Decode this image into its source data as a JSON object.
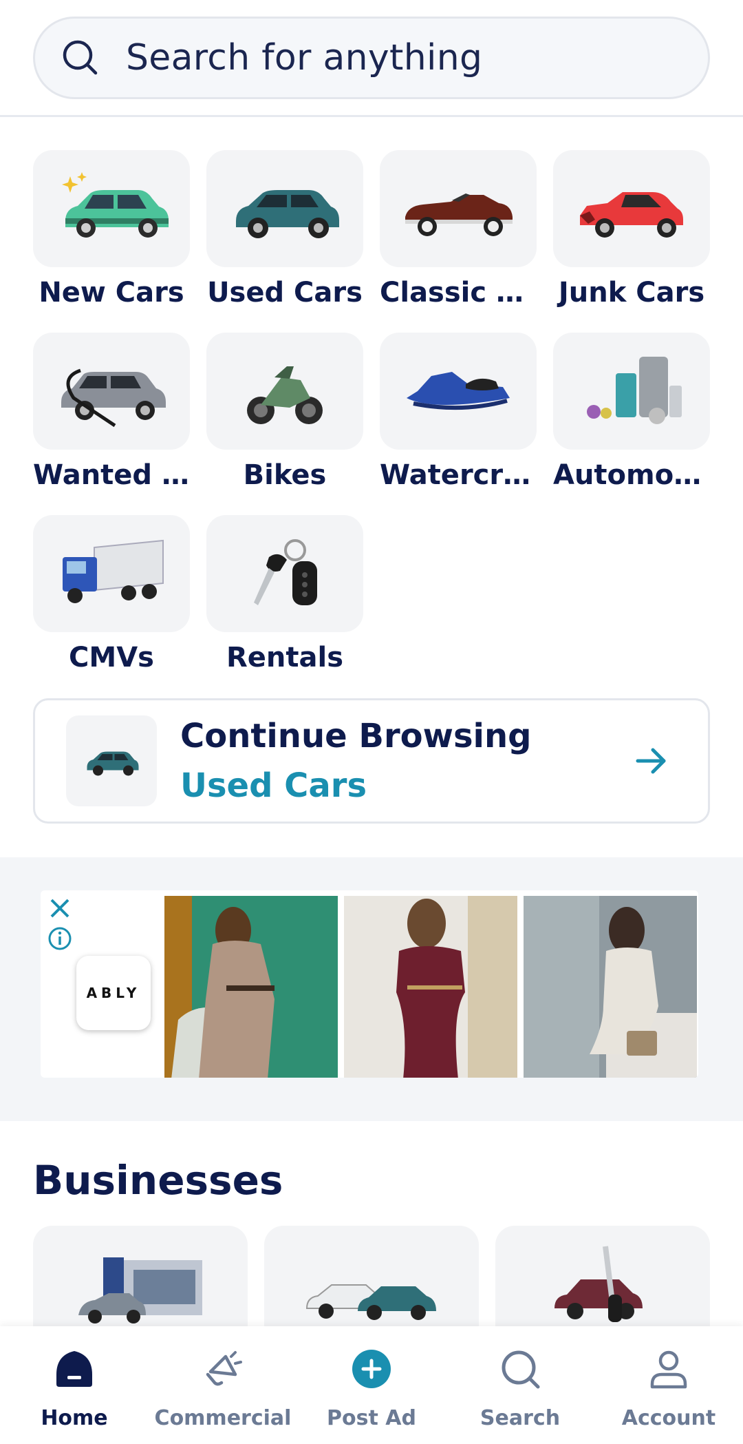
{
  "search": {
    "placeholder": "Search for anything",
    "icon": "search-icon"
  },
  "categories": [
    {
      "label": "New Cars",
      "icon": "new-car-icon"
    },
    {
      "label": "Used Cars",
      "icon": "used-car-icon"
    },
    {
      "label": "Classic Cars",
      "icon": "classic-car-icon"
    },
    {
      "label": "Junk Cars",
      "icon": "junk-car-icon"
    },
    {
      "label": "Wanted C...",
      "icon": "wanted-car-icon"
    },
    {
      "label": "Bikes",
      "icon": "bike-icon"
    },
    {
      "label": "Watercraft",
      "icon": "watercraft-icon"
    },
    {
      "label": "Automoti...",
      "icon": "automotive-parts-icon"
    },
    {
      "label": "CMVs",
      "icon": "truck-icon"
    },
    {
      "label": "Rentals",
      "icon": "car-keys-icon"
    }
  ],
  "continue_browsing": {
    "title": "Continue Browsing",
    "subtitle": "Used Cars"
  },
  "ad": {
    "brand": "ABLY"
  },
  "businesses": {
    "title": "Businesses"
  },
  "nav": [
    {
      "label": "Home",
      "icon": "home-icon",
      "active": true
    },
    {
      "label": "Commercial",
      "icon": "megaphone-icon",
      "active": false
    },
    {
      "label": "Post Ad",
      "icon": "plus-circle-icon",
      "active": false
    },
    {
      "label": "Search",
      "icon": "search-icon",
      "active": false
    },
    {
      "label": "Account",
      "icon": "user-icon",
      "active": false
    }
  ],
  "colors": {
    "navy": "#0e1b4d",
    "accent": "#1a8fb0",
    "muted": "#6b7a94",
    "tile": "#f3f4f6"
  }
}
